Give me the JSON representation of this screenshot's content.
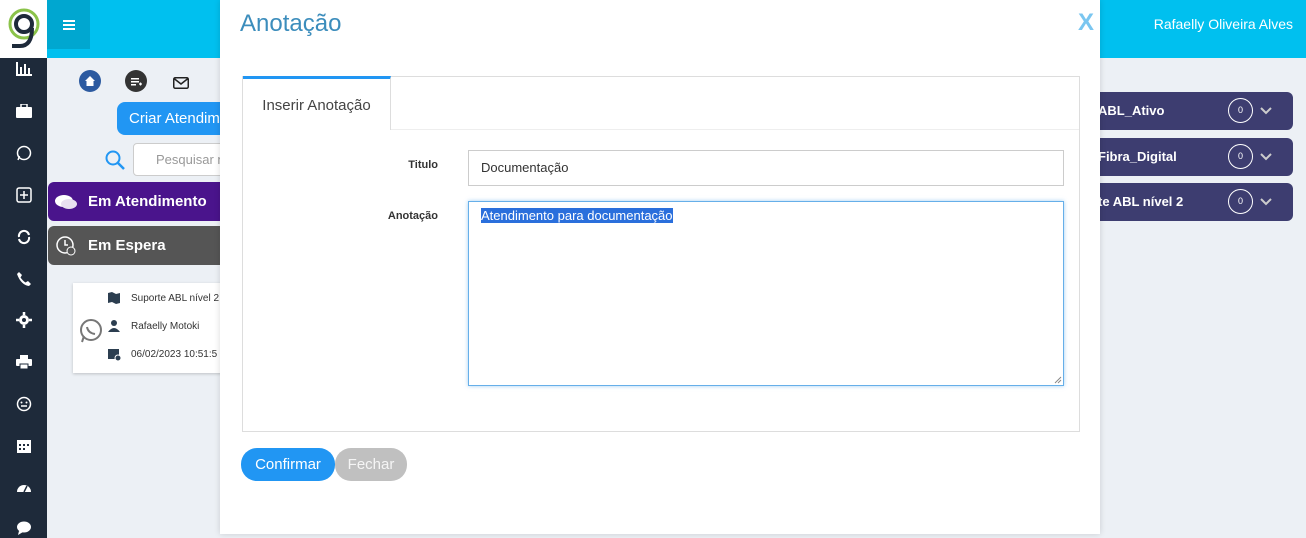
{
  "app": {
    "user_name": "Rafaelly Oliveira Alves"
  },
  "sidebar": {
    "icons": [
      "chart-icon",
      "briefcase-icon",
      "whatsapp-icon",
      "plus-square-icon",
      "refresh-icon",
      "phone-icon",
      "gear-icon",
      "printer-icon",
      "smile-icon",
      "calendar-icon",
      "dashboard-icon",
      "chat-icon"
    ]
  },
  "main": {
    "create_button": "Criar Atendimento",
    "search_placeholder": "Pesquisar n",
    "tabs": [
      {
        "label": "Em Atendimento",
        "color": "#4a148c"
      },
      {
        "label": "Em Espera",
        "color": "#555555"
      }
    ],
    "card": {
      "queue": "Suporte ABL nível 2",
      "agent": "Rafaelly Motoki",
      "datetime": "06/02/2023 10:51:5"
    }
  },
  "queues": [
    {
      "label": "ABL_Ativo",
      "count": "0"
    },
    {
      "label": "Fibra_Digital",
      "count": "0"
    },
    {
      "label": "te ABL nível 2",
      "count": "0"
    }
  ],
  "modal": {
    "title": "Anotação",
    "close_label": "X",
    "tab_label": "Inserir Anotação",
    "titulo_label": "Titulo",
    "titulo_value": "Documentação",
    "anotacao_label": "Anotação",
    "anotacao_value": "Atendimento para documentação",
    "confirm_label": "Confirmar",
    "close_button_label": "Fechar"
  },
  "colors": {
    "topbar": "#00c0ef",
    "accent": "#2196f3",
    "rail": "#1e2a3a",
    "queue": "#3d3d70"
  }
}
